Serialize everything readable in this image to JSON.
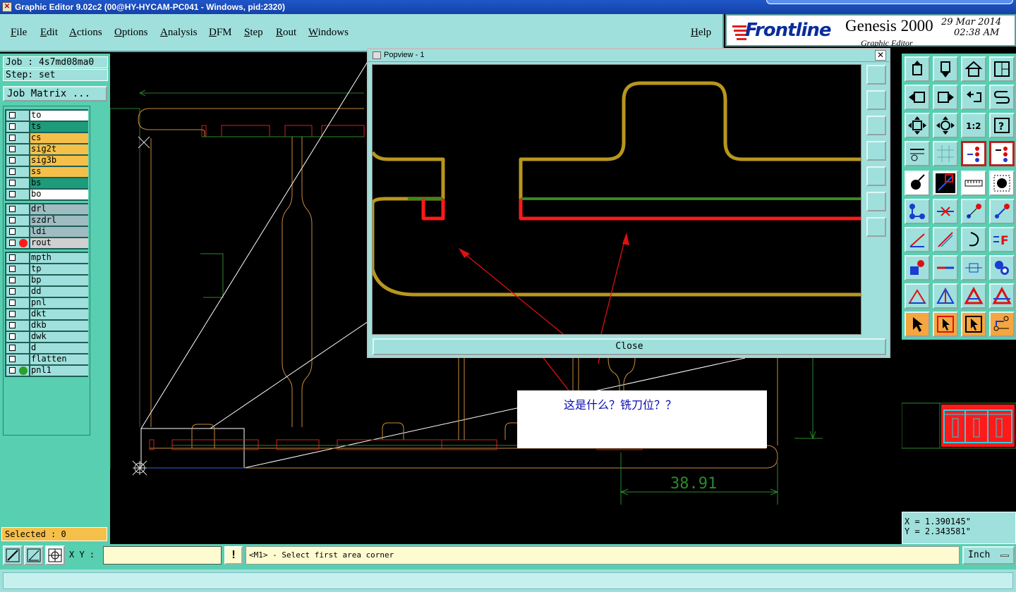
{
  "window": {
    "title": "Graphic Editor 9.02c2 (00@HY-HYCAM-PC041 - Windows, pid:2320)"
  },
  "menu": {
    "items": [
      "File",
      "Edit",
      "Actions",
      "Options",
      "Analysis",
      "DFM",
      "Step",
      "Rout",
      "Windows"
    ],
    "help": "Help"
  },
  "brand": {
    "logo": "Frontline",
    "product": "Genesis 2000",
    "subtitle": "Graphic Editor",
    "date": "29 Mar 2014",
    "time": "02:38 AM"
  },
  "job": {
    "job_label": "Job : 4s7md08ma0",
    "step_label": "Step: set",
    "matrix_button": "Job Matrix ..."
  },
  "layers": {
    "group1": [
      {
        "name": "to",
        "color": "#ffffff"
      },
      {
        "name": "ts",
        "color": "#1e9b7a"
      },
      {
        "name": "cs",
        "color": "#f5c04a"
      },
      {
        "name": "sig2t",
        "color": "#f5c04a"
      },
      {
        "name": "sig3b",
        "color": "#f5c04a"
      },
      {
        "name": "ss",
        "color": "#f5c04a"
      },
      {
        "name": "bs",
        "color": "#1e9b7a"
      },
      {
        "name": "bo",
        "color": "#ffffff"
      }
    ],
    "group2": [
      {
        "name": "drl",
        "color": "#9fbcc2"
      },
      {
        "name": "szdrl",
        "color": "#9fbcc2"
      },
      {
        "name": "ldi",
        "color": "#9fbcc2"
      },
      {
        "name": "rout",
        "color": "#d0d0d0",
        "dot": "#ff1a1a"
      }
    ],
    "group3": [
      {
        "name": "mpth",
        "color": "#9fe0dc"
      },
      {
        "name": "tp",
        "color": "#9fe0dc"
      },
      {
        "name": "bp",
        "color": "#9fe0dc"
      },
      {
        "name": "dd",
        "color": "#9fe0dc"
      },
      {
        "name": "pnl",
        "color": "#9fe0dc"
      },
      {
        "name": "dkt",
        "color": "#9fe0dc"
      },
      {
        "name": "dkb",
        "color": "#9fe0dc"
      },
      {
        "name": "dwk",
        "color": "#9fe0dc"
      },
      {
        "name": "d",
        "color": "#9fe0dc"
      },
      {
        "name": "flatten",
        "color": "#9fe0dc"
      },
      {
        "name": "pnl1",
        "color": "#9fe0dc",
        "dot": "#2ca02c"
      }
    ]
  },
  "selected": "Selected : 0",
  "popview": {
    "title": "Popview - 1",
    "close_button": "Close"
  },
  "annotation": "这是什么？铣刀位？？",
  "dimension": "38.91",
  "coords": {
    "x": "X = 1.390145\"",
    "y": "Y = 2.343581\""
  },
  "bottom": {
    "xy_label": "X Y :",
    "xy_value": "",
    "prompt": "<M1> - Select first area corner",
    "units": "Inch",
    "warn": "!"
  }
}
